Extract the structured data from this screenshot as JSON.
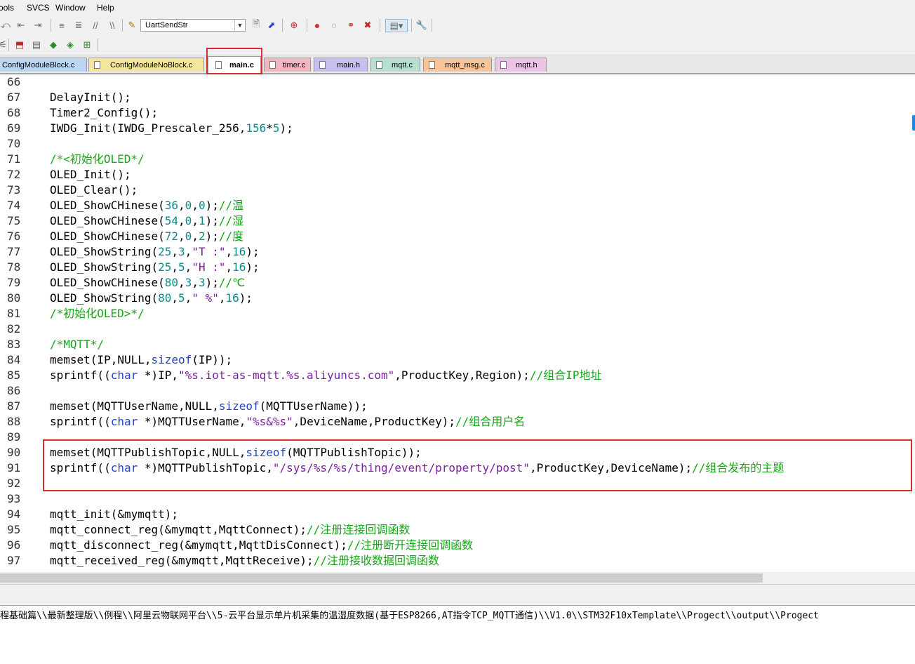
{
  "menu": [
    "Tools",
    "SVCS",
    "Window",
    "Help"
  ],
  "toolbar": {
    "target_combo": "UartSendStr"
  },
  "tabs": [
    {
      "label": "ConfigModuleBlock.c",
      "color": "#bcd6f2",
      "active": false
    },
    {
      "label": "ConfigModuleNoBlock.c",
      "color": "#f4e79c",
      "active": false
    },
    {
      "label": "main.c",
      "color": "#ffffff",
      "active": true
    },
    {
      "label": "timer.c",
      "color": "#f4b6c0",
      "active": false
    },
    {
      "label": "main.h",
      "color": "#c6c0ee",
      "active": false
    },
    {
      "label": "mqtt.c",
      "color": "#b7e0d1",
      "active": false
    },
    {
      "label": "mqtt_msg.c",
      "color": "#f7c59a",
      "active": false
    },
    {
      "label": "mqtt.h",
      "color": "#ebc4e6",
      "active": false
    }
  ],
  "code_lines": [
    {
      "num": "66",
      "tokens": []
    },
    {
      "num": "67",
      "tokens": [
        [
          "t",
          "DelayInit();"
        ]
      ]
    },
    {
      "num": "68",
      "tokens": [
        [
          "t",
          "Timer2_Config();"
        ]
      ]
    },
    {
      "num": "69",
      "tokens": [
        [
          "t",
          "IWDG_Init(IWDG_Prescaler_256,"
        ],
        [
          "n",
          "156"
        ],
        [
          "t",
          "*"
        ],
        [
          "n",
          "5"
        ],
        [
          "t",
          ");"
        ]
      ]
    },
    {
      "num": "70",
      "tokens": []
    },
    {
      "num": "71",
      "tokens": [
        [
          "c",
          "/*<初始化OLED*/"
        ]
      ]
    },
    {
      "num": "72",
      "tokens": [
        [
          "t",
          "OLED_Init();"
        ]
      ]
    },
    {
      "num": "73",
      "tokens": [
        [
          "t",
          "OLED_Clear();"
        ]
      ]
    },
    {
      "num": "74",
      "tokens": [
        [
          "t",
          "OLED_ShowCHinese("
        ],
        [
          "n",
          "36"
        ],
        [
          "t",
          ","
        ],
        [
          "n",
          "0"
        ],
        [
          "t",
          ","
        ],
        [
          "n",
          "0"
        ],
        [
          "t",
          ");"
        ],
        [
          "c",
          "//温"
        ]
      ]
    },
    {
      "num": "75",
      "tokens": [
        [
          "t",
          "OLED_ShowCHinese("
        ],
        [
          "n",
          "54"
        ],
        [
          "t",
          ","
        ],
        [
          "n",
          "0"
        ],
        [
          "t",
          ","
        ],
        [
          "n",
          "1"
        ],
        [
          "t",
          ");"
        ],
        [
          "c",
          "//湿"
        ]
      ]
    },
    {
      "num": "76",
      "tokens": [
        [
          "t",
          "OLED_ShowCHinese("
        ],
        [
          "n",
          "72"
        ],
        [
          "t",
          ","
        ],
        [
          "n",
          "0"
        ],
        [
          "t",
          ","
        ],
        [
          "n",
          "2"
        ],
        [
          "t",
          ");"
        ],
        [
          "c",
          "//度"
        ]
      ]
    },
    {
      "num": "77",
      "tokens": [
        [
          "t",
          "OLED_ShowString("
        ],
        [
          "n",
          "25"
        ],
        [
          "t",
          ","
        ],
        [
          "n",
          "3"
        ],
        [
          "t",
          ","
        ],
        [
          "s",
          "\"T :\""
        ],
        [
          "t",
          ","
        ],
        [
          "n",
          "16"
        ],
        [
          "t",
          ");"
        ]
      ]
    },
    {
      "num": "78",
      "tokens": [
        [
          "t",
          "OLED_ShowString("
        ],
        [
          "n",
          "25"
        ],
        [
          "t",
          ","
        ],
        [
          "n",
          "5"
        ],
        [
          "t",
          ","
        ],
        [
          "s",
          "\"H :\""
        ],
        [
          "t",
          ","
        ],
        [
          "n",
          "16"
        ],
        [
          "t",
          ");"
        ]
      ]
    },
    {
      "num": "79",
      "tokens": [
        [
          "t",
          "OLED_ShowCHinese("
        ],
        [
          "n",
          "80"
        ],
        [
          "t",
          ","
        ],
        [
          "n",
          "3"
        ],
        [
          "t",
          ","
        ],
        [
          "n",
          "3"
        ],
        [
          "t",
          ");"
        ],
        [
          "c",
          "//℃"
        ]
      ]
    },
    {
      "num": "80",
      "tokens": [
        [
          "t",
          "OLED_ShowString("
        ],
        [
          "n",
          "80"
        ],
        [
          "t",
          ","
        ],
        [
          "n",
          "5"
        ],
        [
          "t",
          ","
        ],
        [
          "s",
          "\" %\""
        ],
        [
          "t",
          ","
        ],
        [
          "n",
          "16"
        ],
        [
          "t",
          ");"
        ]
      ]
    },
    {
      "num": "81",
      "tokens": [
        [
          "c",
          "/*初始化OLED>*/"
        ]
      ]
    },
    {
      "num": "82",
      "tokens": []
    },
    {
      "num": "83",
      "tokens": [
        [
          "c",
          "/*MQTT*/"
        ]
      ]
    },
    {
      "num": "84",
      "tokens": [
        [
          "t",
          "memset(IP,NULL,"
        ],
        [
          "k",
          "sizeof"
        ],
        [
          "t",
          "(IP));"
        ]
      ]
    },
    {
      "num": "85",
      "tokens": [
        [
          "t",
          "sprintf(("
        ],
        [
          "k",
          "char"
        ],
        [
          "t",
          " *)IP,"
        ],
        [
          "s",
          "\"%s.iot-as-mqtt.%s.aliyuncs.com\""
        ],
        [
          "t",
          ",ProductKey,Region);"
        ],
        [
          "c",
          "//组合IP地址"
        ]
      ]
    },
    {
      "num": "86",
      "tokens": []
    },
    {
      "num": "87",
      "tokens": [
        [
          "t",
          "memset(MQTTUserName,NULL,"
        ],
        [
          "k",
          "sizeof"
        ],
        [
          "t",
          "(MQTTUserName));"
        ]
      ]
    },
    {
      "num": "88",
      "tokens": [
        [
          "t",
          "sprintf(("
        ],
        [
          "k",
          "char"
        ],
        [
          "t",
          " *)MQTTUserName,"
        ],
        [
          "s",
          "\"%s&%s\""
        ],
        [
          "t",
          ",DeviceName,ProductKey);"
        ],
        [
          "c",
          "//组合用户名"
        ]
      ]
    },
    {
      "num": "89",
      "tokens": []
    },
    {
      "num": "90",
      "tokens": [
        [
          "t",
          "memset(MQTTPublishTopic,NULL,"
        ],
        [
          "k",
          "sizeof"
        ],
        [
          "t",
          "(MQTTPublishTopic));"
        ]
      ]
    },
    {
      "num": "91",
      "tokens": [
        [
          "t",
          "sprintf(("
        ],
        [
          "k",
          "char"
        ],
        [
          "t",
          " *)MQTTPublishTopic,"
        ],
        [
          "s",
          "\"/sys/%s/%s/thing/event/property/post\""
        ],
        [
          "t",
          ",ProductKey,DeviceName);"
        ],
        [
          "c",
          "//组合发布的主题"
        ]
      ]
    },
    {
      "num": "92",
      "tokens": []
    },
    {
      "num": "93",
      "tokens": []
    },
    {
      "num": "94",
      "tokens": [
        [
          "t",
          "mqtt_init(&mymqtt);"
        ]
      ]
    },
    {
      "num": "95",
      "tokens": [
        [
          "t",
          "mqtt_connect_reg(&mymqtt,MqttConnect);"
        ],
        [
          "c",
          "//注册连接回调函数"
        ]
      ]
    },
    {
      "num": "96",
      "tokens": [
        [
          "t",
          "mqtt_disconnect_reg(&mymqtt,MqttDisConnect);"
        ],
        [
          "c",
          "//注册断开连接回调函数"
        ]
      ]
    },
    {
      "num": "97",
      "tokens": [
        [
          "t",
          "mqtt_received_reg(&mymqtt,MqttReceive);"
        ],
        [
          "c",
          "//注册接收数据回调函数"
        ]
      ]
    }
  ],
  "output": {
    "text": "程基础篇\\\\最新整理版\\\\例程\\\\阿里云物联网平台\\\\5-云平台显示单片机采集的温湿度数据(基于ESP8266,AT指令TCP_MQTT通信)\\\\V1.0\\\\STM32F10xTemplate\\\\Progect\\\\output\\\\Progect"
  },
  "colors": {
    "comment": "#19a519",
    "keyword": "#2343c8",
    "number": "#0c8a8a",
    "string": "#7c1fa0",
    "highlight_border": "#d32f2f"
  }
}
